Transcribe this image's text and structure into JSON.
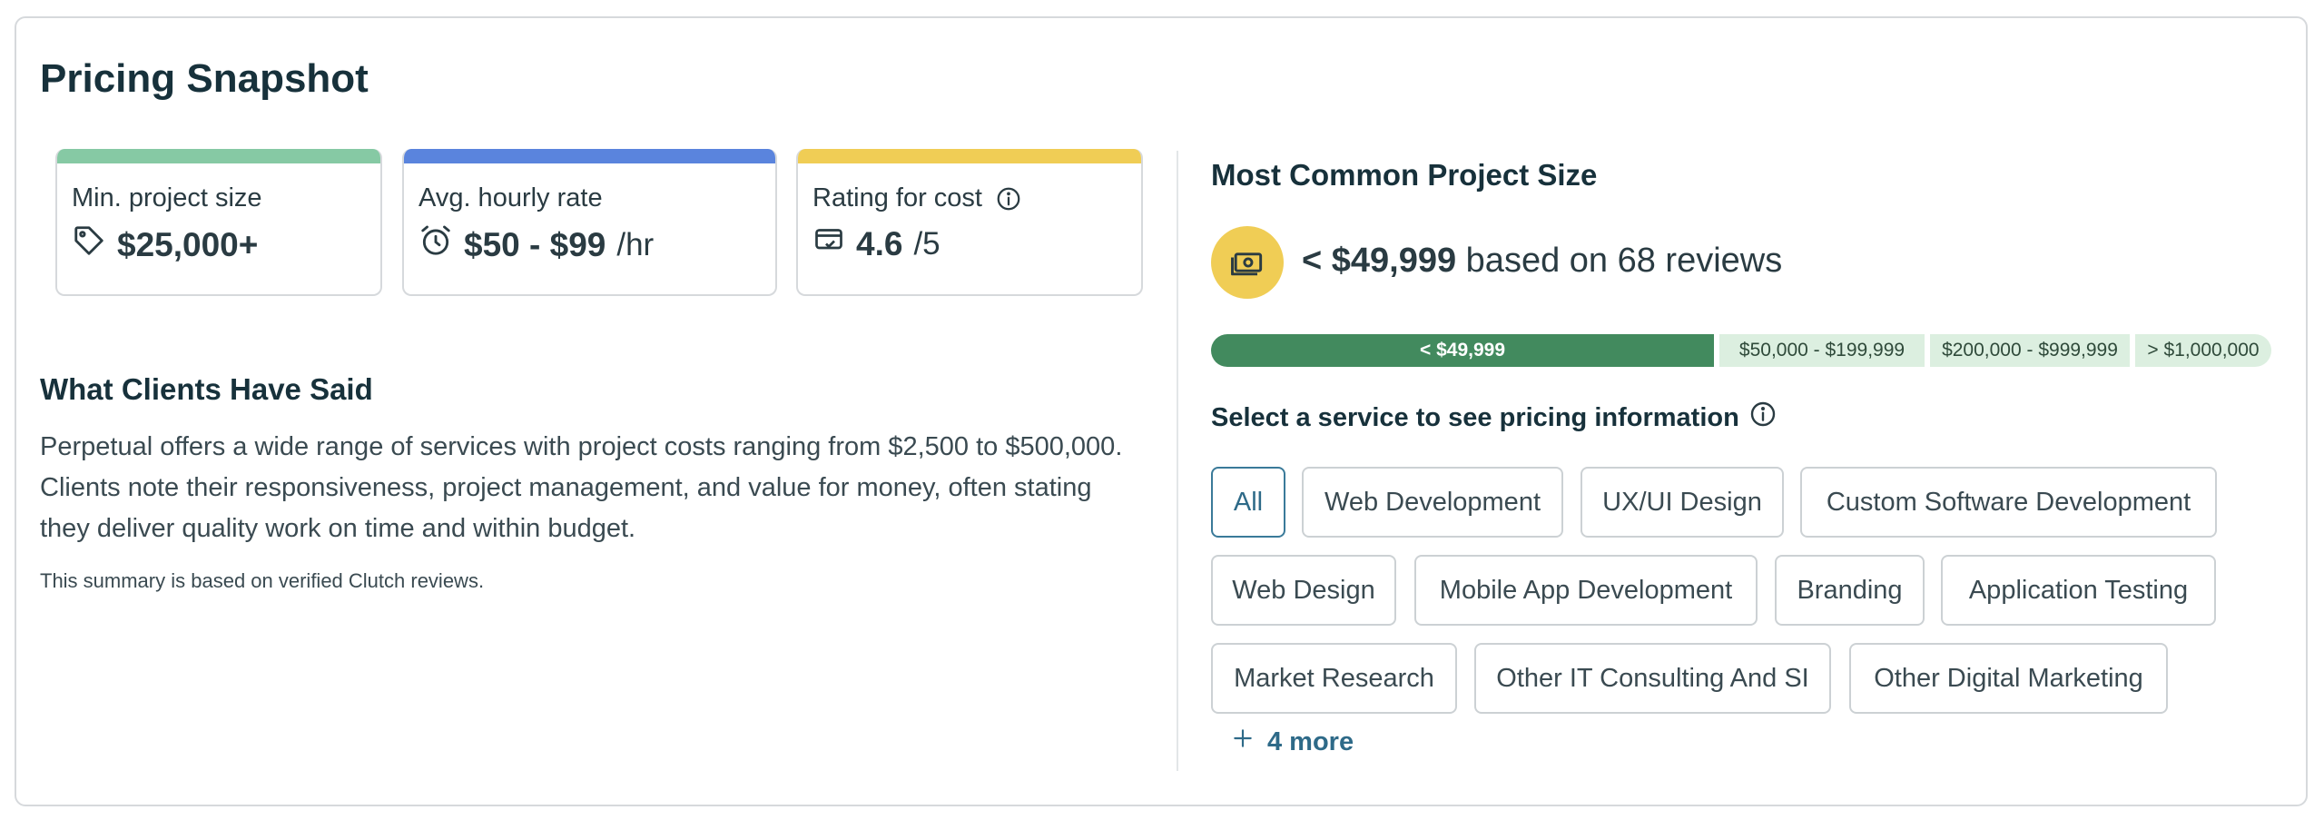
{
  "title": "Pricing Snapshot",
  "stats": [
    {
      "label": "Min. project size",
      "value": "$25,000+",
      "unit": "",
      "icon": "price-tag-icon",
      "color": "#86c9a4"
    },
    {
      "label": "Avg. hourly rate",
      "value": "$50 - $99",
      "unit": "/hr",
      "icon": "alarm-clock-icon",
      "color": "#5a84dd"
    },
    {
      "label": "Rating for cost",
      "value": "4.6",
      "unit": "/5",
      "icon": "credit-card-icon",
      "color": "#f0cd55"
    }
  ],
  "clients": {
    "heading": "What Clients Have Said",
    "summary": "Perpetual offers a wide range of services with project costs ranging from $2,500 to $500,000. Clients note their responsiveness, project management, and value for money, often stating they deliver quality work on time and within budget.",
    "note": "This summary is based on verified Clutch reviews."
  },
  "project_size": {
    "heading": "Most Common Project Size",
    "value": "< $49,999",
    "suffix": "based on 68 reviews",
    "segments": [
      {
        "label": "< $49,999",
        "active": true
      },
      {
        "label": "$50,000 - $199,999",
        "active": false
      },
      {
        "label": "$200,000 - $999,999",
        "active": false
      },
      {
        "label": "> $1,000,000",
        "active": false
      }
    ]
  },
  "services": {
    "heading": "Select a service to see pricing information",
    "items": [
      "All",
      "Web Development",
      "UX/UI Design",
      "Custom Software Development",
      "Web Design",
      "Mobile App Development",
      "Branding",
      "Application Testing",
      "Market Research",
      "Other IT Consulting And SI",
      "Other Digital Marketing"
    ],
    "selected": "All",
    "more_label": "4 more"
  }
}
